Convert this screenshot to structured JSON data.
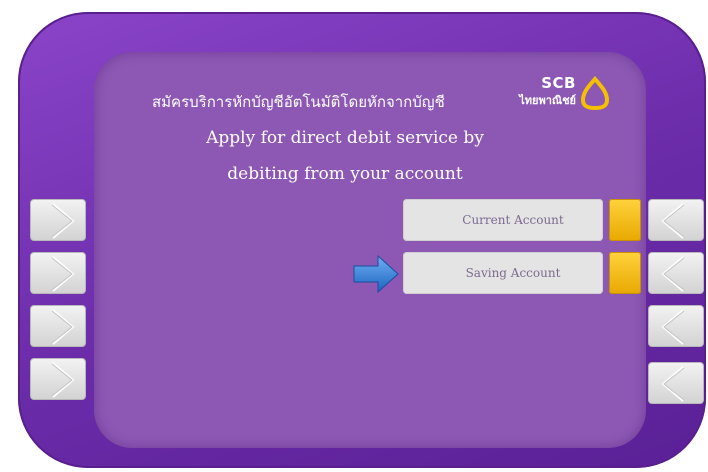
{
  "header": {
    "thai_title": "สมัครบริการหักบัญชีอัตโนมัติโดยหักจากบัญชี",
    "english_line_1": "Apply for direct debit service by",
    "english_line_2": "debiting from your account"
  },
  "logo": {
    "brand": "SCB",
    "thai_name": "ไทยพาณิชย์",
    "icon": "scb-logo-icon"
  },
  "options": [
    {
      "label": "Current Account",
      "marker_color": "#f5b800"
    },
    {
      "label": "Saving Account",
      "marker_color": "#f5b800",
      "pointed": true
    }
  ],
  "colors": {
    "bezel": "#6a2ba8",
    "screen": "#8c58b4",
    "pointer": "#2f7ed8"
  }
}
